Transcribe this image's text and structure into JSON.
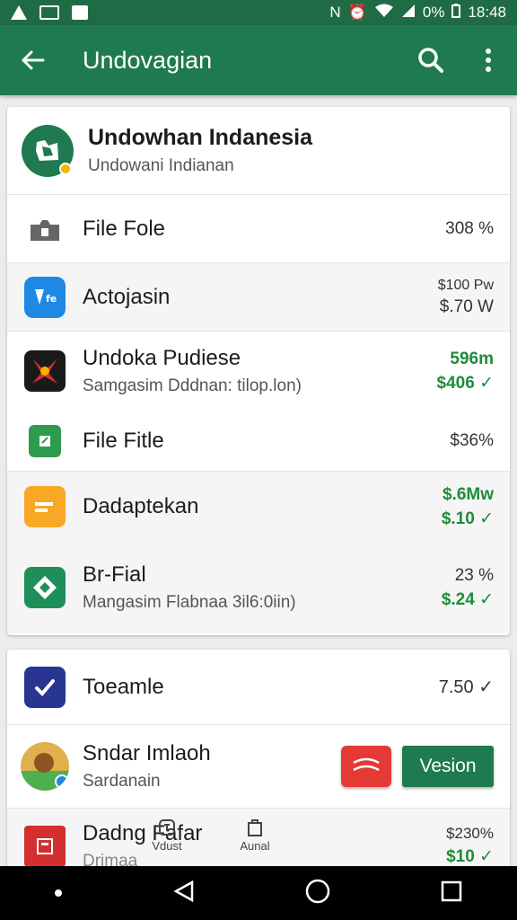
{
  "status_bar": {
    "battery": "0%",
    "time": "18:48"
  },
  "app_bar": {
    "title": "Undovagian"
  },
  "header": {
    "name": "Undowhan Indanesia",
    "subtitle": "Undowani Indianan"
  },
  "list": [
    {
      "name": "File Fole",
      "value1": "308 %",
      "value2": ""
    },
    {
      "name": "Actojasin",
      "value1": "$100 Pw",
      "value2": "$.70 W"
    },
    {
      "name": "Undoka Pudiese",
      "subtitle": "Samgasim Dddnan: tilop.lon)",
      "value1": "596m",
      "value2": "$406 ✓"
    },
    {
      "name": "File Fitle",
      "value1": "$36%",
      "value2": ""
    },
    {
      "name": "Dadaptekan",
      "value1": "$.6Mw",
      "value2": "$.10 ✓"
    },
    {
      "name": "Br-Fial",
      "subtitle": "Mangasim Flabnaa 3il6:0iin)",
      "value1": "23 %",
      "value2": "$.24 ✓"
    }
  ],
  "list2": [
    {
      "name": "Toeamle",
      "value1": "7.50 ✓"
    },
    {
      "name": "Sndar Imlaoh",
      "subtitle": "Sardanain",
      "button": "Vesion"
    },
    {
      "name": "Dadng Fafar",
      "subtitle": "Drimaa",
      "value1": "$230%",
      "value2": "$10 ✓"
    }
  ],
  "bottom_tabs": [
    {
      "label": "Vdust"
    },
    {
      "label": "Aunal"
    }
  ],
  "colors": {
    "primary": "#1f7a4f",
    "status": "#1f6b45",
    "positive": "#1e8c3a"
  }
}
